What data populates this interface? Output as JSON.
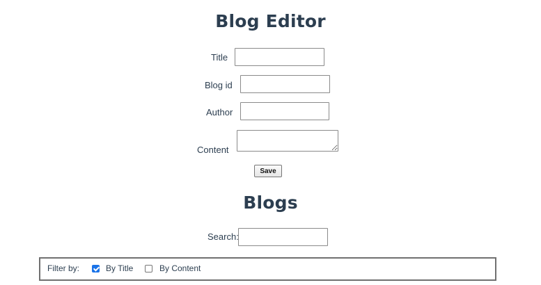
{
  "editor": {
    "heading": "Blog Editor",
    "fields": {
      "title": {
        "label": "Title",
        "value": ""
      },
      "blog_id": {
        "label": "Blog id",
        "value": ""
      },
      "author": {
        "label": "Author",
        "value": ""
      },
      "content": {
        "label": "Content",
        "value": ""
      }
    },
    "save_label": "Save"
  },
  "blogs": {
    "heading": "Blogs",
    "search": {
      "label": "Search:",
      "value": ""
    },
    "filter": {
      "label": "Filter by:",
      "options": [
        {
          "label": "By Title",
          "checked": true
        },
        {
          "label": "By Content",
          "checked": false
        }
      ]
    }
  },
  "colors": {
    "heading": "#2c3e50",
    "checkbox_accent": "#1a73e8"
  }
}
